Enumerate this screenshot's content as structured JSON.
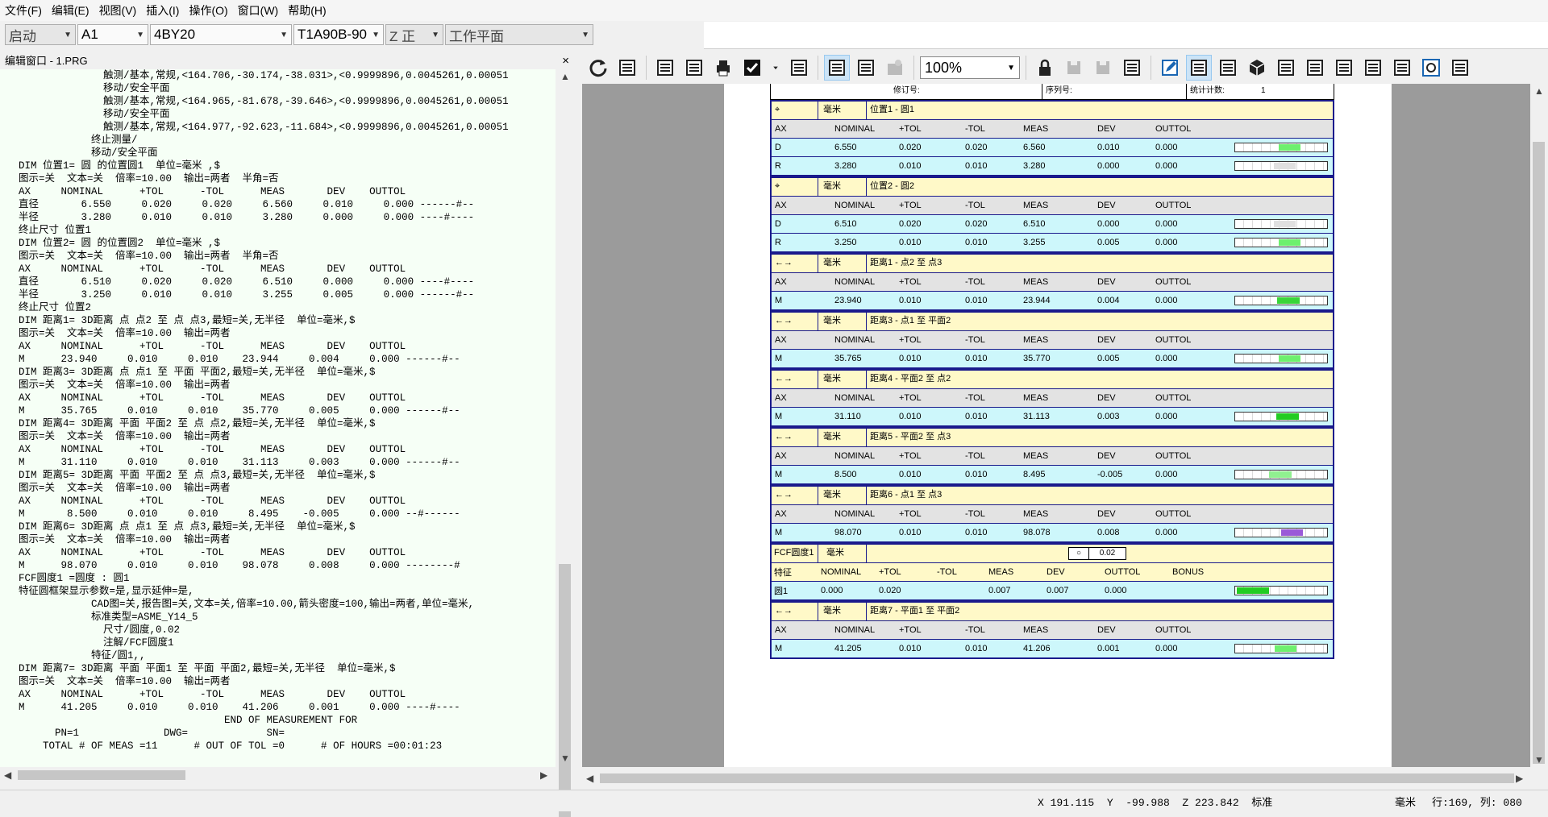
{
  "menu": [
    "文件(F)",
    "编辑(E)",
    "视图(V)",
    "插入(I)",
    "操作(O)",
    "窗口(W)",
    "帮助(H)"
  ],
  "combos": {
    "mode": "启动",
    "probe": "A1",
    "tip": "4BY20",
    "angle": "T1A90B-90",
    "axis": "Z 正",
    "plane": "工作平面"
  },
  "zoom": "100%",
  "toolbar_icons": [
    "refresh-icon",
    "layout-icon",
    "report-screen-icon",
    "report-image-icon",
    "print-icon",
    "check-icon",
    "dropdown-arrow-icon",
    "add-item-icon",
    "template-icon",
    "add-report-icon",
    "disabled-icon",
    "lock-icon",
    "save-icon",
    "save-as-icon",
    "copy-icon",
    "edit-icon",
    "text-report-icon",
    "form-icon",
    "cube-icon",
    "table-icon",
    "window-icon",
    "list-icon",
    "lines-icon",
    "calc-icon",
    "target-icon",
    "checklist-icon"
  ],
  "editor": {
    "title": "编辑窗口 - 1.PRG",
    "close": "×",
    "lines": [
      "              触测/基本,常规,<164.706,-30.174,-38.031>,<0.9999896,0.0045261,0.00051",
      "              移动/安全平面",
      "              触测/基本,常规,<164.965,-81.678,-39.646>,<0.9999896,0.0045261,0.00051",
      "              移动/安全平面",
      "              触测/基本,常规,<164.977,-92.623,-11.684>,<0.9999896,0.0045261,0.00051",
      "            终止测量/",
      "            移动/安全平面",
      "DIM 位置1= 圆 的位置圆1  单位=毫米 ,$",
      "图示=关  文本=关  倍率=10.00  输出=两者  半角=否",
      "AX     NOMINAL      +TOL      -TOL      MEAS       DEV    OUTTOL",
      "直径       6.550     0.020     0.020     6.560     0.010     0.000 ------#--",
      "半径       3.280     0.010     0.010     3.280     0.000     0.000 ----#----",
      "终止尺寸 位置1",
      "DIM 位置2= 圆 的位置圆2  单位=毫米 ,$",
      "图示=关  文本=关  倍率=10.00  输出=两者  半角=否",
      "AX     NOMINAL      +TOL      -TOL      MEAS       DEV    OUTTOL",
      "直径       6.510     0.020     0.020     6.510     0.000     0.000 ----#----",
      "半径       3.250     0.010     0.010     3.255     0.005     0.000 ------#--",
      "终止尺寸 位置2",
      "DIM 距离1= 3D距离 点 点2 至 点 点3,最短=关,无半径  单位=毫米,$",
      "图示=关  文本=关  倍率=10.00  输出=两者",
      "AX     NOMINAL      +TOL      -TOL      MEAS       DEV    OUTTOL",
      "M      23.940     0.010     0.010    23.944     0.004     0.000 ------#--",
      "DIM 距离3= 3D距离 点 点1 至 平面 平面2,最短=关,无半径  单位=毫米,$",
      "图示=关  文本=关  倍率=10.00  输出=两者",
      "AX     NOMINAL      +TOL      -TOL      MEAS       DEV    OUTTOL",
      "M      35.765     0.010     0.010    35.770     0.005     0.000 ------#--",
      "DIM 距离4= 3D距离 平面 平面2 至 点 点2,最短=关,无半径  单位=毫米,$",
      "图示=关  文本=关  倍率=10.00  输出=两者",
      "AX     NOMINAL      +TOL      -TOL      MEAS       DEV    OUTTOL",
      "M      31.110     0.010     0.010    31.113     0.003     0.000 ------#--",
      "DIM 距离5= 3D距离 平面 平面2 至 点 点3,最短=关,无半径  单位=毫米,$",
      "图示=关  文本=关  倍率=10.00  输出=两者",
      "AX     NOMINAL      +TOL      -TOL      MEAS       DEV    OUTTOL",
      "M       8.500     0.010     0.010     8.495    -0.005     0.000 --#------",
      "DIM 距离6= 3D距离 点 点1 至 点 点3,最短=关,无半径  单位=毫米,$",
      "图示=关  文本=关  倍率=10.00  输出=两者",
      "AX     NOMINAL      +TOL      -TOL      MEAS       DEV    OUTTOL",
      "M      98.070     0.010     0.010    98.078     0.008     0.000 --------#",
      "FCF圆度1 =圆度 : 圆1",
      "特征圆框架显示参数=是,显示延伸=是,",
      "            CAD图=关,报告图=关,文本=关,倍率=10.00,箭头密度=100,输出=两者,单位=毫米,",
      "            标准类型=ASME_Y14_5",
      "              尺寸/圆度,0.02",
      "              注解/FCF圆度1",
      "            特征/圆1,,",
      "DIM 距离7= 3D距离 平面 平面1 至 平面 平面2,最短=关,无半径  单位=毫米,$",
      "图示=关  文本=关  倍率=10.00  输出=两者",
      "AX     NOMINAL      +TOL      -TOL      MEAS       DEV    OUTTOL",
      "M      41.205     0.010     0.010    41.206     0.001     0.000 ----#----",
      "                                  END OF MEASUREMENT FOR",
      "      PN=1              DWG=             SN=",
      "    TOTAL # OF MEAS =11      # OUT OF TOL =0      # OF HOURS =00:01:23"
    ]
  },
  "report": {
    "header": [
      "修订号:",
      "序列号:",
      "统计计数:",
      "1"
    ],
    "columns": [
      "AX",
      "NOMINAL",
      "+TOL",
      "-TOL",
      "MEAS",
      "DEV",
      "OUTTOL"
    ],
    "blocks": [
      {
        "icon": "⌖",
        "unit": "毫米",
        "title": "位置1 - 圆1",
        "rows": [
          {
            "ax": "D",
            "nom": "6.550",
            "pt": "0.020",
            "mt": "0.020",
            "ms": "6.560",
            "dv": "0.010",
            "ot": "0.000",
            "level": 0.55,
            "color": "#6df06d"
          },
          {
            "ax": "R",
            "nom": "3.280",
            "pt": "0.010",
            "mt": "0.010",
            "ms": "3.280",
            "dv": "0.000",
            "ot": "0.000",
            "level": 0.5,
            "color": "#e0e0e0"
          }
        ]
      },
      {
        "icon": "⌖",
        "unit": "毫米",
        "title": "位置2 - 圆2",
        "rows": [
          {
            "ax": "D",
            "nom": "6.510",
            "pt": "0.020",
            "mt": "0.020",
            "ms": "6.510",
            "dv": "0.000",
            "ot": "0.000",
            "level": 0.5,
            "color": "#e0e0e0"
          },
          {
            "ax": "R",
            "nom": "3.250",
            "pt": "0.010",
            "mt": "0.010",
            "ms": "3.255",
            "dv": "0.005",
            "ot": "0.000",
            "level": 0.55,
            "color": "#6df06d"
          }
        ]
      },
      {
        "icon": "←→",
        "unit": "毫米",
        "title": "距离1 - 点2 至 点3",
        "rows": [
          {
            "ax": "M",
            "nom": "23.940",
            "pt": "0.010",
            "mt": "0.010",
            "ms": "23.944",
            "dv": "0.004",
            "ot": "0.000",
            "level": 0.54,
            "color": "#39d539"
          }
        ]
      },
      {
        "icon": "←→",
        "unit": "毫米",
        "title": "距离3 - 点1 至 平面2",
        "rows": [
          {
            "ax": "M",
            "nom": "35.765",
            "pt": "0.010",
            "mt": "0.010",
            "ms": "35.770",
            "dv": "0.005",
            "ot": "0.000",
            "level": 0.55,
            "color": "#6df06d"
          }
        ]
      },
      {
        "icon": "←→",
        "unit": "毫米",
        "title": "距离4 - 平面2 至 点2",
        "rows": [
          {
            "ax": "M",
            "nom": "31.110",
            "pt": "0.010",
            "mt": "0.010",
            "ms": "31.113",
            "dv": "0.003",
            "ot": "0.000",
            "level": 0.53,
            "color": "#22cc22"
          }
        ]
      },
      {
        "icon": "←→",
        "unit": "毫米",
        "title": "距离5 - 平面2 至 点3",
        "rows": [
          {
            "ax": "M",
            "nom": "8.500",
            "pt": "0.010",
            "mt": "0.010",
            "ms": "8.495",
            "dv": "-0.005",
            "ot": "0.000",
            "level": 0.45,
            "color": "#90f090"
          }
        ]
      },
      {
        "icon": "←→",
        "unit": "毫米",
        "title": "距离6 - 点1 至 点3",
        "rows": [
          {
            "ax": "M",
            "nom": "98.070",
            "pt": "0.010",
            "mt": "0.010",
            "ms": "98.078",
            "dv": "0.008",
            "ot": "0.000",
            "level": 0.58,
            "color": "#9a5ad8"
          }
        ]
      }
    ],
    "fcf": {
      "label": "FCF圆度1",
      "unit": "毫米",
      "symbol": "○",
      "tol": "0.02",
      "columns": [
        "特征",
        "NOMINAL",
        "+TOL",
        "-TOL",
        "MEAS",
        "DEV",
        "OUTTOL",
        "BONUS"
      ],
      "row": {
        "feat": "圆1",
        "nom": "0.000",
        "pt": "0.020",
        "mt": "",
        "ms": "0.007",
        "dv": "0.007",
        "ot": "0.000",
        "bonus": "",
        "level": 0.35,
        "color": "#22cc22"
      }
    },
    "last": {
      "icon": "←→",
      "unit": "毫米",
      "title": "距离7 - 平面1 至 平面2",
      "rows": [
        {
          "ax": "M",
          "nom": "41.205",
          "pt": "0.010",
          "mt": "0.010",
          "ms": "41.206",
          "dv": "0.001",
          "ot": "0.000",
          "level": 0.51,
          "color": "#6df06d"
        }
      ]
    }
  },
  "status": {
    "coords": "X 191.115  Y  -99.988  Z 223.842  标准",
    "unit": "毫米",
    "position": "行:169, 列: 080"
  }
}
